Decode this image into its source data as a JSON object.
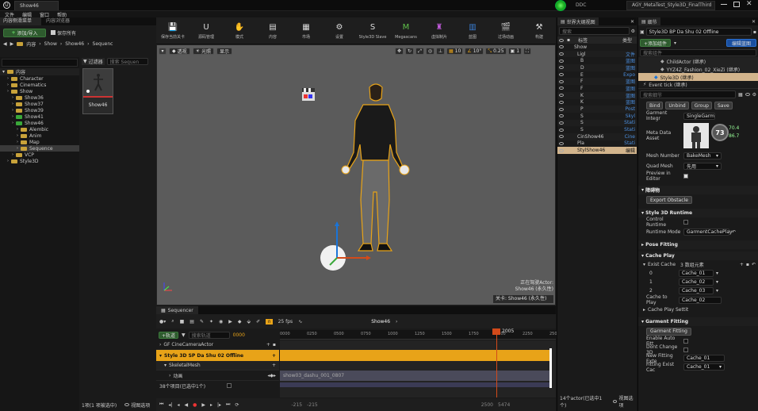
{
  "app": {
    "title": "Show46",
    "project_title": "AGY_MetaTest_Style3D_FinalThird",
    "ddc": "DDC",
    "menu": [
      "文件",
      "编辑",
      "窗口",
      "帮助"
    ]
  },
  "content_browser": {
    "tabs": [
      "内容侧滑菜单",
      "内容浏览器"
    ],
    "add_label": "添加/导入",
    "save_all": "保存所有",
    "path": [
      "内容",
      "Show",
      "Show46",
      "Sequenc"
    ],
    "filter": "过滤器",
    "search_placeholder": "搜索 Sequen",
    "tree_root": "内容",
    "tree": [
      {
        "label": "Character",
        "indent": 1,
        "green": false
      },
      {
        "label": "Cinematics",
        "indent": 1,
        "green": false
      },
      {
        "label": "Show",
        "indent": 1,
        "green": false
      },
      {
        "label": "Show36",
        "indent": 2,
        "green": false
      },
      {
        "label": "Show37",
        "indent": 2,
        "green": false
      },
      {
        "label": "Show39",
        "indent": 2,
        "green": false
      },
      {
        "label": "Show41",
        "indent": 2,
        "green": true
      },
      {
        "label": "Show46",
        "indent": 2,
        "green": true
      },
      {
        "label": "Alembic",
        "indent": 3,
        "green": false
      },
      {
        "label": "Anim",
        "indent": 3,
        "green": false
      },
      {
        "label": "Map",
        "indent": 3,
        "green": false
      },
      {
        "label": "Sequence",
        "indent": 3,
        "green": false,
        "selected": true
      },
      {
        "label": "VCP",
        "indent": 2,
        "green": false
      },
      {
        "label": "Style3D",
        "indent": 1,
        "green": false
      }
    ],
    "asset_name": "Show46",
    "status": "1项(1 项被选中)",
    "view_options": "视图选项"
  },
  "toolbar": {
    "items": [
      "保存当前关卡",
      "源码管理",
      "模式",
      "内容",
      "市场",
      "设置",
      "Style3D Slave",
      "Megascans",
      "虚拟制片",
      "蓝图",
      "过场动画",
      "构建"
    ]
  },
  "viewport": {
    "perspective": "透视",
    "lit": "光照",
    "show": "显示",
    "grid_snap": "10",
    "rot_snap": "10°",
    "scale_snap": "0.25",
    "cam_speed": "1",
    "level_info_1": "关卡: Show46 (永久性)",
    "pilot_line_1": "正在驾驶Actor:",
    "pilot_line_2": "Show46 (永久性)",
    "stat_line_1": "",
    "stat_line_2": ""
  },
  "sequencer": {
    "tab": "Sequencer",
    "fps": "25 fps",
    "sequence_name": "Show46",
    "track_btn": "+轨道",
    "search_placeholder": "搜索轨道",
    "current_frame": "2005",
    "frame_start": "0000",
    "tracks": [
      "GF CineCameraActor",
      "Style 3D SP Da Shu 02 Offline",
      "SkeletalMesh",
      "动画",
      "38个项目(已选中1个)"
    ],
    "ruler": [
      "0000",
      "0250",
      "0500",
      "0750",
      "1000",
      "1250",
      "1500",
      "1750",
      "2000",
      "2250",
      "2500"
    ],
    "anim_clip": "show03_dashu_001_0807",
    "bottom_left": "-215",
    "bottom_mid": "-215",
    "bottom_right_1": "2500",
    "bottom_right_2": "5474"
  },
  "outliner": {
    "tab": "世界大纲视图",
    "search_placeholder": "搜索",
    "col_label": "标签",
    "col_type": "类型",
    "items": [
      {
        "label": "Show",
        "type": ""
      },
      {
        "label": "Ligl",
        "type": "文件"
      },
      {
        "label": "B",
        "type": "蓝图"
      },
      {
        "label": "D",
        "type": "蓝图"
      },
      {
        "label": "E",
        "type": "Expo"
      },
      {
        "label": "F",
        "type": "蓝图"
      },
      {
        "label": "F",
        "type": "蓝图"
      },
      {
        "label": "K",
        "type": "蓝图"
      },
      {
        "label": "K",
        "type": "蓝图"
      },
      {
        "label": "P",
        "type": "Post"
      },
      {
        "label": "S",
        "type": "Skyl"
      },
      {
        "label": "S",
        "type": "Stati"
      },
      {
        "label": "S",
        "type": "Stati"
      },
      {
        "label": "CinShow46",
        "type": "Cine"
      },
      {
        "label": "Pla",
        "type": "Stati"
      },
      {
        "label": "StylShow46",
        "type": "编辑"
      }
    ],
    "status": "14个actor(已选中1个)",
    "view_options": "视图选项"
  },
  "details": {
    "tab": "细节",
    "name": "Style3D BP Da Shu 02 Offline",
    "add_btn": "+添加组件",
    "edit_bp": "编辑蓝图",
    "search_placeholder": "搜索组件",
    "components": [
      {
        "label": "ChildActor (继承)",
        "selected": false
      },
      {
        "label": "YYZ4Z_Fashion_02_XieZi (继承)",
        "selected": false
      },
      {
        "label": "Style3D (继承)",
        "selected": true
      }
    ],
    "event": "Event tick (继承)",
    "search_details": "搜索细节",
    "buttons": [
      "Bind",
      "Unbind",
      "Group",
      "Save"
    ],
    "garment_integration": "Garment Integr",
    "garment_integration_val": "SingleGarm",
    "meta_data_asset": "Meta Data Asset",
    "mesh_number": "Mesh Number",
    "mesh_number_val": "BakeMesh",
    "quad_mesh": "Quad Mesh",
    "quad_mesh_val": "先用",
    "preview_in_editor": "Preview in Editor",
    "percent": "73",
    "stat_a": "70.4",
    "stat_b": "86.7",
    "sec_obstacle": "障碍物",
    "export_obstacle": "Export Obstacle",
    "sec_runtime": "Style 3D Runtime",
    "control_runtime": "Control Runtime",
    "runtime_mode": "Runtime Mode",
    "runtime_mode_val": "GarmentCachePlay",
    "sec_pose": "Pose Fitting",
    "sec_cache": "Cache Play",
    "exist_cache": "Exist Cache",
    "exist_cache_val": "3 数组元素",
    "cache_rows": [
      {
        "idx": "0",
        "val": "Cache_01"
      },
      {
        "idx": "1",
        "val": "Cache_02"
      },
      {
        "idx": "2",
        "val": "Cache_03"
      }
    ],
    "cache_to_play": "Cache to Play",
    "cache_to_play_val": "Cache_02",
    "cache_play_setting": "Cache Play Settit",
    "sec_garment": "Garment Fitting",
    "garment_fitting_btn": "Garment Fitting",
    "enable_auto_fit": "Enable Auto Fitt",
    "dont_change": "Dont Change 3D",
    "new_fitting_ext": "New Fitting Exte",
    "new_fitting_ext_val": "Cache_01",
    "fitting_exist": "Fitting Exist Cac",
    "fitting_exist_val": "Cache_01"
  },
  "colors": {
    "accent": "#1a74d8",
    "orange": "#e8a318",
    "green_folder": "#3aa83a",
    "folder": "#c8a23a"
  }
}
